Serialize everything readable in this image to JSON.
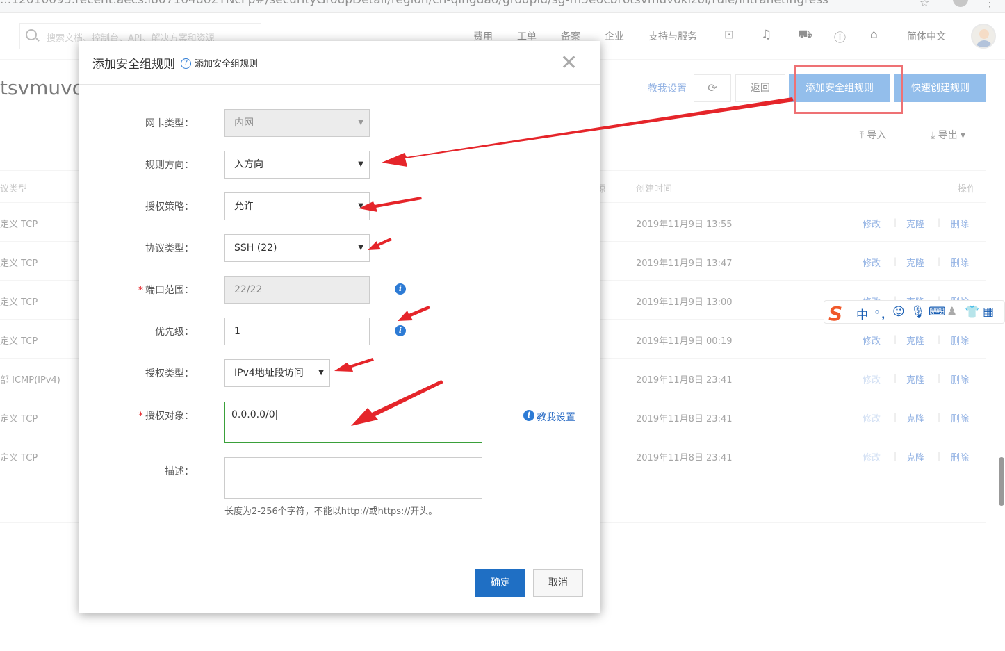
{
  "browser": {
    "url_fragment": "...12010093.recent.aecs.i807104d02TNcFp#/securityGroupDetail/region/cn-qingdao/groupId/sg-m5e6cbr6tsvmuvokiz6i/rule/intranetIngress"
  },
  "topnav": {
    "search_placeholder": "搜索文档、控制台、API、解决方案和资源",
    "items": [
      "费用",
      "工单",
      "备案",
      "企业",
      "支持与服务"
    ],
    "language": "简体中文",
    "icons": [
      "terminal-icon",
      "bell-icon",
      "cart-icon",
      "help-circle-icon",
      "home-icon"
    ]
  },
  "page": {
    "title_fragment": "tsvmuvok",
    "teach_link": "教我设置",
    "back_label": "返回",
    "add_rule_label": "添加安全组规则",
    "quick_create_label": "快速创建规则",
    "import_label": "导入",
    "export_label": "导出",
    "columns": {
      "protocol": "议类型",
      "created": "创建时间",
      "actions": "操作",
      "partial": "源"
    },
    "action_labels": {
      "edit": "修改",
      "clone": "克隆",
      "delete": "删除"
    },
    "rows": [
      {
        "protocol": "定义 TCP",
        "created": "2019年11月9日 13:55",
        "edit_enabled": true
      },
      {
        "protocol": "定义 TCP",
        "created": "2019年11月9日 13:47",
        "edit_enabled": true
      },
      {
        "protocol": "定义 TCP",
        "created": "2019年11月9日 13:00",
        "edit_enabled": true
      },
      {
        "protocol": "定义 TCP",
        "created": "2019年11月9日 00:19",
        "edit_enabled": true
      },
      {
        "protocol": "部 ICMP(IPv4)",
        "created": "2019年11月8日 23:41",
        "edit_enabled": false
      },
      {
        "protocol": "定义 TCP",
        "created": "2019年11月8日 23:41",
        "edit_enabled": false
      },
      {
        "protocol": "定义 TCP",
        "created": "2019年11月8日 23:41",
        "edit_enabled": false
      }
    ]
  },
  "modal": {
    "title": "添加安全组规则",
    "help_label": "添加安全组规则",
    "fields": {
      "nic_type": {
        "label": "网卡类型：",
        "value": "内网"
      },
      "direction": {
        "label": "规则方向：",
        "value": "入方向"
      },
      "policy": {
        "label": "授权策略：",
        "value": "允许"
      },
      "protocol": {
        "label": "协议类型：",
        "value": "SSH (22)"
      },
      "port_range": {
        "label": "端口范围：",
        "value": "22/22",
        "required_mark": "*"
      },
      "priority": {
        "label": "优先级：",
        "value": "1"
      },
      "auth_type": {
        "label": "授权类型：",
        "value": "IPv4地址段访问"
      },
      "auth_object": {
        "label": "授权对象：",
        "value": "0.0.0.0/0",
        "required_mark": "*"
      },
      "description": {
        "label": "描述：",
        "value": ""
      }
    },
    "teach_link": "教我设置",
    "hint": "长度为2-256个字符，不能以http://或https://开头。",
    "ok_label": "确定",
    "cancel_label": "取消"
  },
  "ime": {
    "mode": "中",
    "punct": "°，"
  },
  "colors": {
    "primary": "#1f6fc4",
    "accent_button": "#5a9be0",
    "link": "#5b8bd6",
    "annotation_red": "#e5252a",
    "focus_green": "#3aa03a"
  }
}
